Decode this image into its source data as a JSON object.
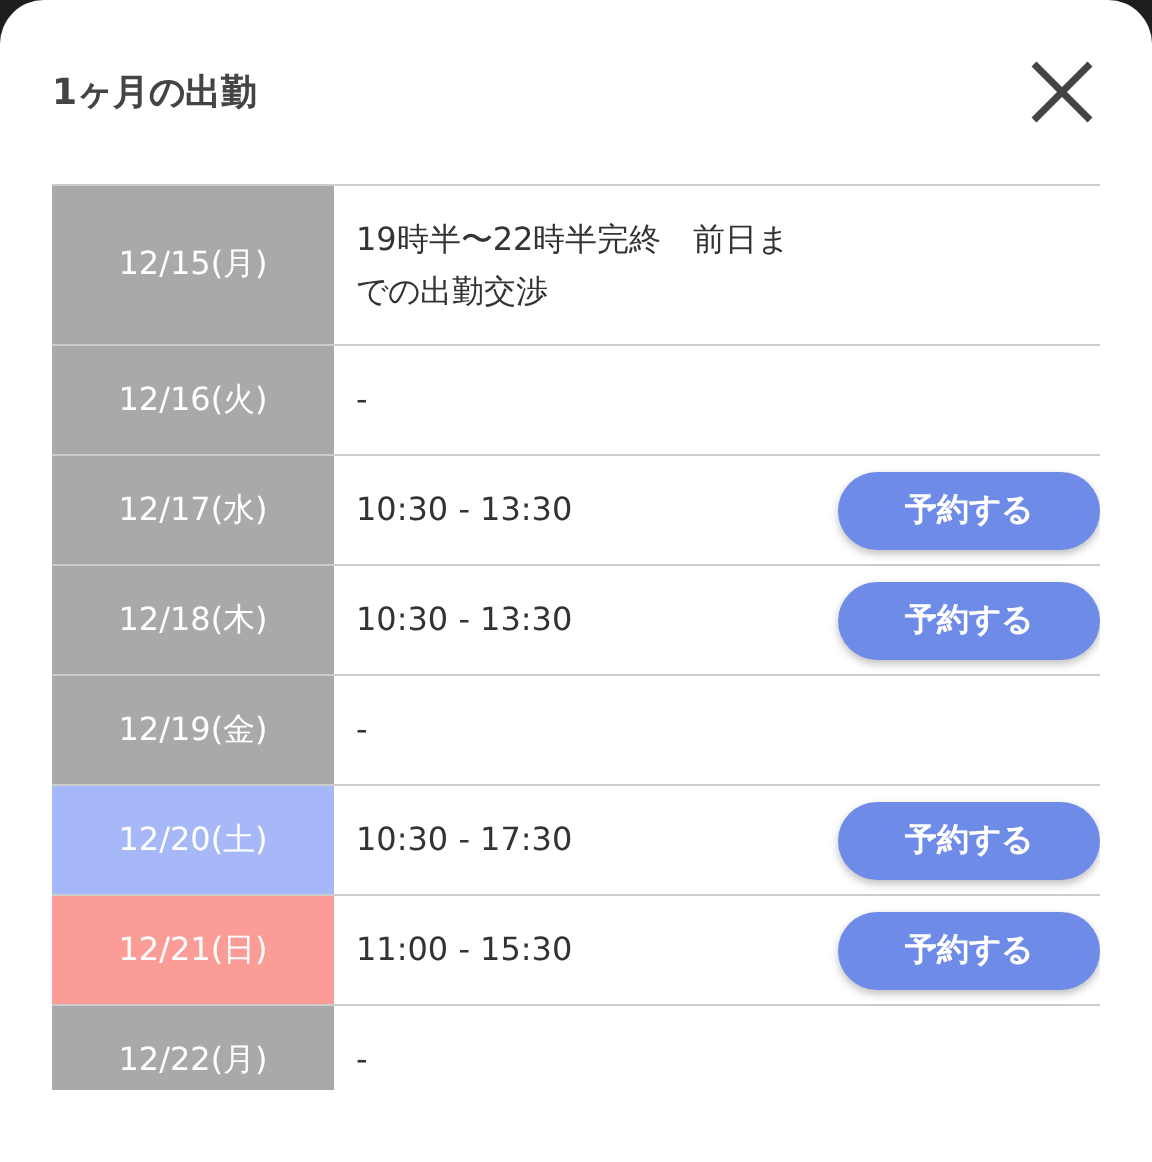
{
  "dialog": {
    "title": "1ヶ月の出勤"
  },
  "rows": [
    {
      "date": "12/15(月)",
      "color": "#a9a9a9",
      "hours": "19時半〜22時半完終　前日までの出勤交渉"
    },
    {
      "date": "12/16(火)",
      "color": "#a9a9a9",
      "hours": "-"
    },
    {
      "date": "12/17(水)",
      "color": "#a9a9a9",
      "hours": "10:30 - 13:30",
      "button": "予約する"
    },
    {
      "date": "12/18(木)",
      "color": "#a9a9a9",
      "hours": "10:30 - 13:30",
      "button": "予約する"
    },
    {
      "date": "12/19(金)",
      "color": "#a9a9a9",
      "hours": "-"
    },
    {
      "date": "12/20(土)",
      "color": "#a7b8f8",
      "hours": "10:30 - 17:30",
      "button": "予約する"
    },
    {
      "date": "12/21(日)",
      "color": "#fb9c97",
      "hours": "11:00 - 15:30",
      "button": "予約する"
    },
    {
      "date": "12/22(月)",
      "color": "#a9a9a9",
      "hours": "-"
    }
  ]
}
